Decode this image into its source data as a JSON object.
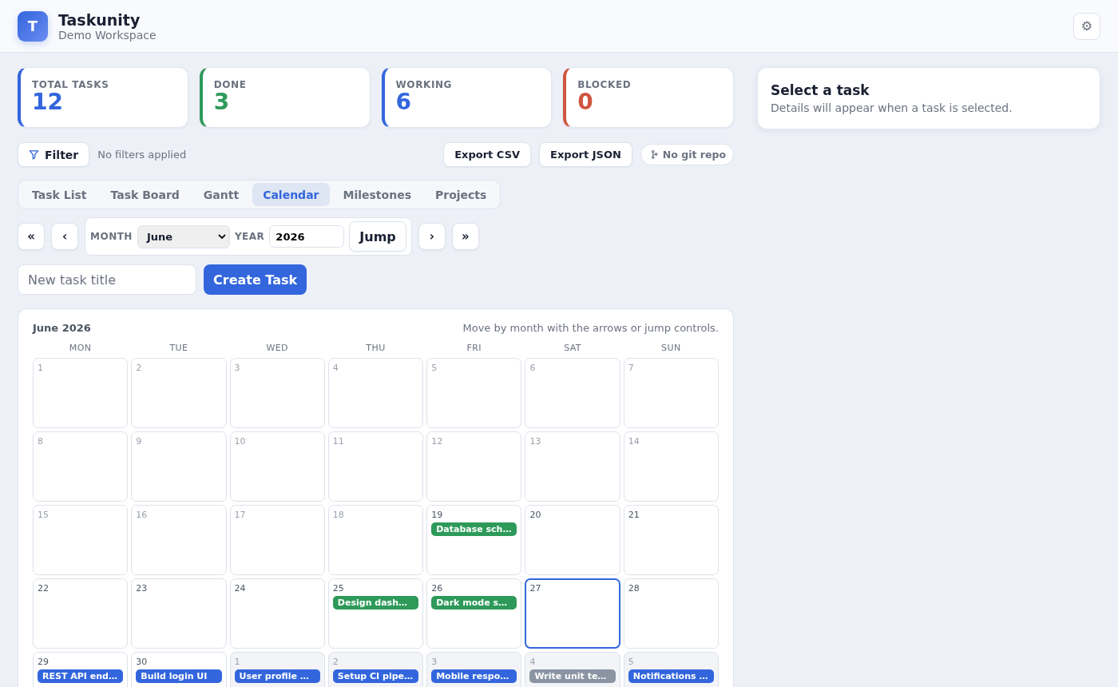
{
  "app": {
    "logo": "T",
    "title": "Taskunity",
    "subtitle": "Demo Workspace",
    "settings": "⚙"
  },
  "stats": [
    {
      "label": "TOTAL TASKS",
      "value": "12",
      "color": "#3366dd"
    },
    {
      "label": "DONE",
      "value": "3",
      "color": "#2e9a5a"
    },
    {
      "label": "WORKING",
      "value": "6",
      "color": "#3366dd"
    },
    {
      "label": "BLOCKED",
      "value": "0",
      "color": "#d0553f"
    }
  ],
  "filter": {
    "label": "Filter",
    "status": "No filters applied"
  },
  "actions": [
    "Export CSV",
    "Export JSON"
  ],
  "git": {
    "label": "No git repo"
  },
  "tabs": [
    {
      "label": "Task List",
      "selected": false
    },
    {
      "label": "Task Board",
      "selected": false
    },
    {
      "label": "Gantt",
      "selected": false
    },
    {
      "label": "Calendar",
      "selected": true
    },
    {
      "label": "Milestones",
      "selected": false
    },
    {
      "label": "Projects",
      "selected": false
    }
  ],
  "nav": {
    "first": "«",
    "prev": "‹",
    "month_label": "MONTH",
    "month": "June",
    "year_label": "YEAR",
    "year": "2026",
    "jump": "Jump",
    "next": "›",
    "last": "»"
  },
  "new_task": {
    "placeholder": "New task title",
    "button": "Create Task"
  },
  "calendar": {
    "title": "June 2026",
    "hint": "Move by month with the arrows or jump controls.",
    "weekdays": [
      "MON",
      "TUE",
      "WED",
      "THU",
      "FRI",
      "SAT",
      "SUN"
    ],
    "days": [
      {
        "day": "1",
        "muted": true,
        "outside": false,
        "today": false
      },
      {
        "day": "2",
        "muted": true,
        "outside": false,
        "today": false
      },
      {
        "day": "3",
        "muted": true,
        "outside": false,
        "today": false
      },
      {
        "day": "4",
        "muted": true,
        "outside": false,
        "today": false
      },
      {
        "day": "5",
        "muted": true,
        "outside": false,
        "today": false
      },
      {
        "day": "6",
        "muted": true,
        "outside": false,
        "today": false
      },
      {
        "day": "7",
        "muted": true,
        "outside": false,
        "today": false
      },
      {
        "day": "8",
        "muted": true,
        "outside": false,
        "today": false
      },
      {
        "day": "9",
        "muted": true,
        "outside": false,
        "today": false
      },
      {
        "day": "10",
        "muted": true,
        "outside": false,
        "today": false
      },
      {
        "day": "11",
        "muted": true,
        "outside": false,
        "today": false
      },
      {
        "day": "12",
        "muted": true,
        "outside": false,
        "today": false
      },
      {
        "day": "13",
        "muted": true,
        "outside": false,
        "today": false
      },
      {
        "day": "14",
        "muted": true,
        "outside": false,
        "today": false
      },
      {
        "day": "15",
        "muted": true,
        "outside": false,
        "today": false
      },
      {
        "day": "16",
        "muted": true,
        "outside": false,
        "today": false
      },
      {
        "day": "17",
        "muted": true,
        "outside": false,
        "today": false
      },
      {
        "day": "18",
        "muted": true,
        "outside": false,
        "today": false
      },
      {
        "day": "19",
        "muted": false,
        "outside": false,
        "today": false,
        "events": [
          {
            "title": "Database sch…",
            "color": "#2e9a5a"
          }
        ]
      },
      {
        "day": "20",
        "muted": false,
        "outside": false,
        "today": false
      },
      {
        "day": "21",
        "muted": false,
        "outside": false,
        "today": false
      },
      {
        "day": "22",
        "muted": false,
        "outside": false,
        "today": false
      },
      {
        "day": "23",
        "muted": false,
        "outside": false,
        "today": false
      },
      {
        "day": "24",
        "muted": false,
        "outside": false,
        "today": false
      },
      {
        "day": "25",
        "muted": false,
        "outside": false,
        "today": false,
        "events": [
          {
            "title": "Design dash…",
            "color": "#2e9a5a"
          }
        ]
      },
      {
        "day": "26",
        "muted": false,
        "outside": false,
        "today": false,
        "events": [
          {
            "title": "Dark mode s…",
            "color": "#2e9a5a"
          }
        ]
      },
      {
        "day": "27",
        "muted": false,
        "outside": false,
        "today": true
      },
      {
        "day": "28",
        "muted": false,
        "outside": false,
        "today": false
      },
      {
        "day": "29",
        "muted": false,
        "outside": false,
        "today": false,
        "events": [
          {
            "title": "REST API end…",
            "color": "#3366dd"
          }
        ]
      },
      {
        "day": "30",
        "muted": false,
        "outside": false,
        "today": false,
        "events": [
          {
            "title": "Build login UI",
            "color": "#3366dd"
          }
        ]
      },
      {
        "day": "1",
        "muted": true,
        "outside": true,
        "today": false,
        "events": [
          {
            "title": "User profile …",
            "color": "#3366dd"
          }
        ]
      },
      {
        "day": "2",
        "muted": true,
        "outside": true,
        "today": false,
        "events": [
          {
            "title": "Setup CI pipe…",
            "color": "#3366dd"
          }
        ]
      },
      {
        "day": "3",
        "muted": true,
        "outside": true,
        "today": false,
        "events": [
          {
            "title": "Mobile respo…",
            "color": "#3366dd"
          }
        ]
      },
      {
        "day": "4",
        "muted": true,
        "outside": true,
        "today": false,
        "events": [
          {
            "title": "Write unit te…",
            "color": "#8a94a3"
          }
        ]
      },
      {
        "day": "5",
        "muted": true,
        "outside": true,
        "today": false,
        "events": [
          {
            "title": "Notifications …",
            "color": "#3366dd"
          }
        ]
      }
    ]
  },
  "details": {
    "title": "Select a task",
    "text": "Details will appear when a task is selected."
  }
}
